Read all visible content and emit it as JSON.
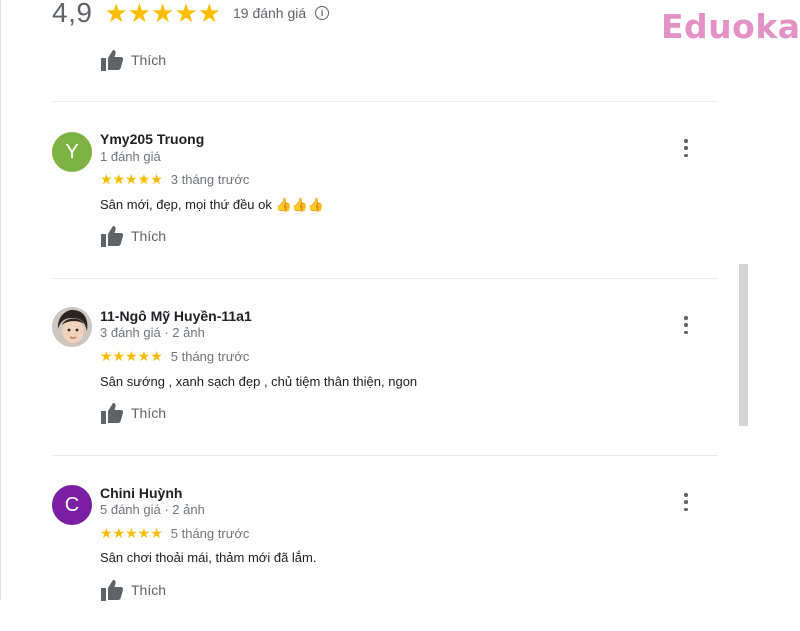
{
  "summary": {
    "rating": "4,9",
    "stars": "★★★★★",
    "count_text": "19 đánh giá",
    "info_glyph": "i"
  },
  "logo_text": "Eduoka",
  "like_label": "Thích",
  "icons": {
    "thumb": "thumbs-up-icon",
    "more": "more-vert-icon",
    "info": "info-icon"
  },
  "reviews": [
    {
      "name": "Ymy205 Truong",
      "avatar_letter": "Y",
      "avatar_color": "#7cb342",
      "meta": "1 đánh giá",
      "stars": "★★★★★",
      "time": "3 tháng trước",
      "text": "Sân mới, đẹp, mọi thứ đều ok 👍👍👍",
      "like_label": "Thích"
    },
    {
      "name": "11-Ngô Mỹ Huyền-11a1",
      "avatar_letter": "",
      "avatar_color": "#8d6e63",
      "meta": "3 đánh giá · 2 ảnh",
      "stars": "★★★★★",
      "time": "5 tháng trước",
      "text": "Sân sướng , xanh sạch đẹp , chủ tiệm thân thiện, ngon",
      "like_label": "Thích"
    },
    {
      "name": "Chini Huỳnh",
      "avatar_letter": "C",
      "avatar_color": "#7b1fa2",
      "meta": "5 đánh giá · 2 ảnh",
      "stars": "★★★★★",
      "time": "5 tháng trước",
      "text": "Sân chơi thoải mái, thảm mới đã lắm.",
      "like_label": "Thích"
    }
  ]
}
